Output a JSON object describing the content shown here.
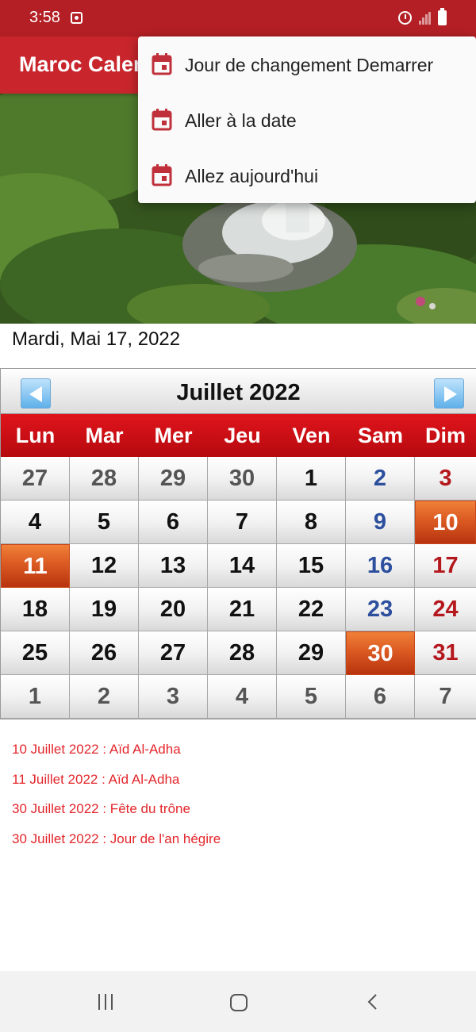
{
  "status_bar": {
    "time": "3:58"
  },
  "app_bar": {
    "title": "Maroc Calendrier"
  },
  "current_date": "Mardi, Mai 17, 2022",
  "calendar": {
    "month_year": "Juillet  2022",
    "weekdays": [
      "Lun",
      "Mar",
      "Mer",
      "Jeu",
      "Ven",
      "Sam",
      "Dim"
    ],
    "weeks": [
      [
        {
          "d": "27",
          "type": "other"
        },
        {
          "d": "28",
          "type": "other"
        },
        {
          "d": "29",
          "type": "other"
        },
        {
          "d": "30",
          "type": "other"
        },
        {
          "d": "1",
          "type": "normal"
        },
        {
          "d": "2",
          "type": "sat"
        },
        {
          "d": "3",
          "type": "sun"
        }
      ],
      [
        {
          "d": "4",
          "type": "normal"
        },
        {
          "d": "5",
          "type": "normal"
        },
        {
          "d": "6",
          "type": "normal"
        },
        {
          "d": "7",
          "type": "normal"
        },
        {
          "d": "8",
          "type": "normal"
        },
        {
          "d": "9",
          "type": "sat"
        },
        {
          "d": "10",
          "type": "holiday"
        }
      ],
      [
        {
          "d": "11",
          "type": "holiday"
        },
        {
          "d": "12",
          "type": "normal"
        },
        {
          "d": "13",
          "type": "normal"
        },
        {
          "d": "14",
          "type": "normal"
        },
        {
          "d": "15",
          "type": "normal"
        },
        {
          "d": "16",
          "type": "sat"
        },
        {
          "d": "17",
          "type": "sun"
        }
      ],
      [
        {
          "d": "18",
          "type": "normal"
        },
        {
          "d": "19",
          "type": "normal"
        },
        {
          "d": "20",
          "type": "normal"
        },
        {
          "d": "21",
          "type": "normal"
        },
        {
          "d": "22",
          "type": "normal"
        },
        {
          "d": "23",
          "type": "sat"
        },
        {
          "d": "24",
          "type": "sun"
        }
      ],
      [
        {
          "d": "25",
          "type": "normal"
        },
        {
          "d": "26",
          "type": "normal"
        },
        {
          "d": "27",
          "type": "normal"
        },
        {
          "d": "28",
          "type": "normal"
        },
        {
          "d": "29",
          "type": "normal"
        },
        {
          "d": "30",
          "type": "holiday"
        },
        {
          "d": "31",
          "type": "sun"
        }
      ],
      [
        {
          "d": "1",
          "type": "other"
        },
        {
          "d": "2",
          "type": "other"
        },
        {
          "d": "3",
          "type": "other"
        },
        {
          "d": "4",
          "type": "other"
        },
        {
          "d": "5",
          "type": "other"
        },
        {
          "d": "6",
          "type": "other"
        },
        {
          "d": "7",
          "type": "other"
        }
      ]
    ]
  },
  "holidays": [
    "10 Juillet 2022 : Aïd Al-Adha",
    "11 Juillet 2022 : Aïd Al-Adha",
    "30 Juillet 2022 : Fête du trône",
    "30 Juillet 2022 : Jour de l'an hégire"
  ],
  "menu": {
    "items": [
      {
        "label": "Jour de changement Demarrer",
        "icon": "calendar-icon"
      },
      {
        "label": "Aller à la date",
        "icon": "calendar-icon"
      },
      {
        "label": "Allez aujourd'hui",
        "icon": "calendar-icon"
      }
    ]
  },
  "colors": {
    "status_bar": "#b31f24",
    "app_bar": "#c8262c",
    "weekday_header": "#d11118",
    "holiday_cell": "#db5a22",
    "saturday": "#2c4f9e",
    "sunday": "#b4181d",
    "holiday_text": "#e3262b"
  }
}
